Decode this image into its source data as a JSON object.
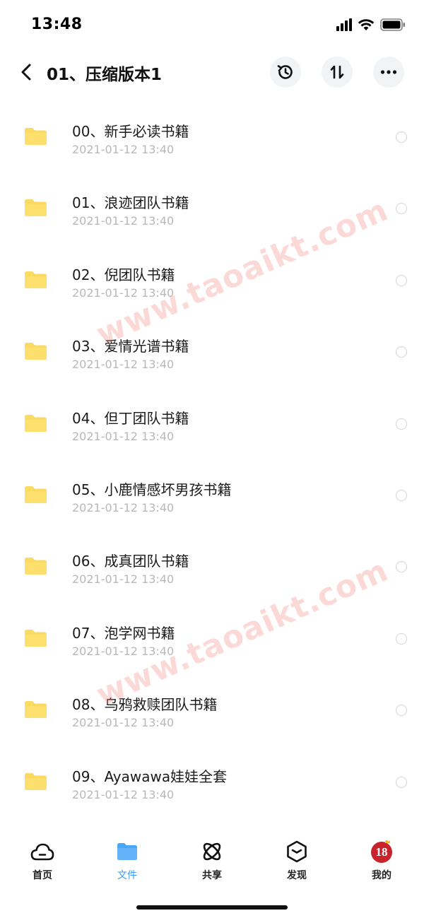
{
  "status_bar": {
    "time": "13:48"
  },
  "header": {
    "title": "01、压缩版本1"
  },
  "files": [
    {
      "name": "00、新手必读书籍",
      "date": "2021-01-12 13:40"
    },
    {
      "name": "01、浪迹团队书籍",
      "date": "2021-01-12 13:40"
    },
    {
      "name": "02、倪团队书籍",
      "date": "2021-01-12 13:40"
    },
    {
      "name": "03、爱情光谱书籍",
      "date": "2021-01-12 13:40"
    },
    {
      "name": "04、但丁团队书籍",
      "date": "2021-01-12 13:40"
    },
    {
      "name": "05、小鹿情感坏男孩书籍",
      "date": "2021-01-12 13:40"
    },
    {
      "name": "06、成真团队书籍",
      "date": "2021-01-12 13:40"
    },
    {
      "name": "07、泡学网书籍",
      "date": "2021-01-12 13:40"
    },
    {
      "name": "08、乌鸦救赎团队书籍",
      "date": "2021-01-12 13:40"
    },
    {
      "name": "09、Ayawawa娃娃全套",
      "date": "2021-01-12 13:40"
    }
  ],
  "watermark": "www.taoaikt.com",
  "tabs": [
    {
      "label": "首页",
      "icon": "cloud-icon"
    },
    {
      "label": "文件",
      "icon": "folder-icon",
      "active": true
    },
    {
      "label": "共享",
      "icon": "atom-icon"
    },
    {
      "label": "发现",
      "icon": "hexagon-icon"
    },
    {
      "label": "我的",
      "icon": "avatar-icon",
      "avatar_text": "18"
    }
  ],
  "colors": {
    "accent": "#3a9bf4",
    "folder": "#fcd960",
    "date_gray": "#b6b8bd"
  }
}
